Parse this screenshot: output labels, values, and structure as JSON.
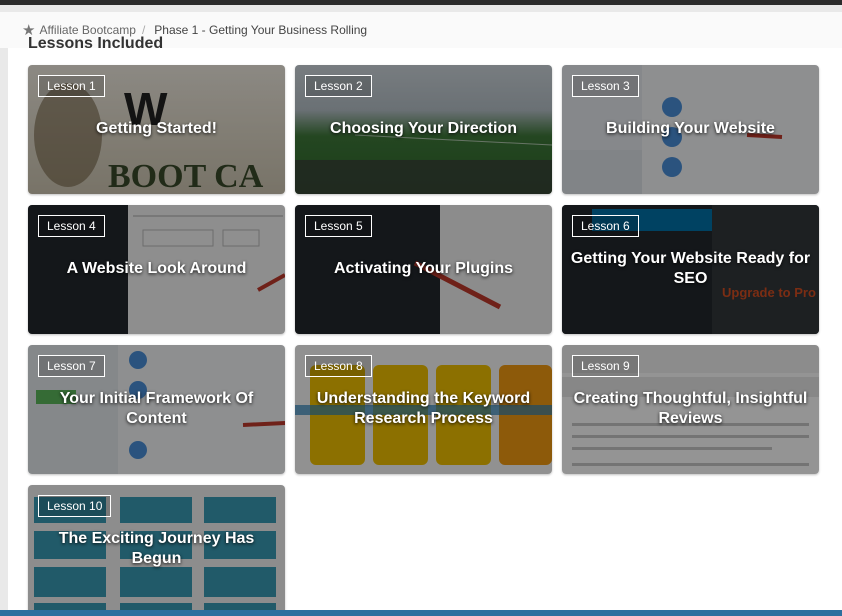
{
  "breadcrumb": {
    "home_label": "Affiliate Bootcamp",
    "separator": "/",
    "current_label": "Phase 1 - Getting Your Business Rolling"
  },
  "section_heading": "Lessons Included",
  "lessons": [
    {
      "badge": "Lesson 1",
      "title": "Getting Started!"
    },
    {
      "badge": "Lesson 2",
      "title": "Choosing Your Direction"
    },
    {
      "badge": "Lesson 3",
      "title": "Building Your Website"
    },
    {
      "badge": "Lesson 4",
      "title": "A Website Look Around"
    },
    {
      "badge": "Lesson 5",
      "title": "Activating Your Plugins"
    },
    {
      "badge": "Lesson 6",
      "title": "Getting Your Website Ready for SEO"
    },
    {
      "badge": "Lesson 7",
      "title": "Your Initial Framework Of Content"
    },
    {
      "badge": "Lesson 8",
      "title": "Understanding the Keyword Research Process"
    },
    {
      "badge": "Lesson 9",
      "title": "Creating Thoughtful, Insightful Reviews"
    },
    {
      "badge": "Lesson 10",
      "title": "The Exciting Journey Has Begun"
    }
  ]
}
